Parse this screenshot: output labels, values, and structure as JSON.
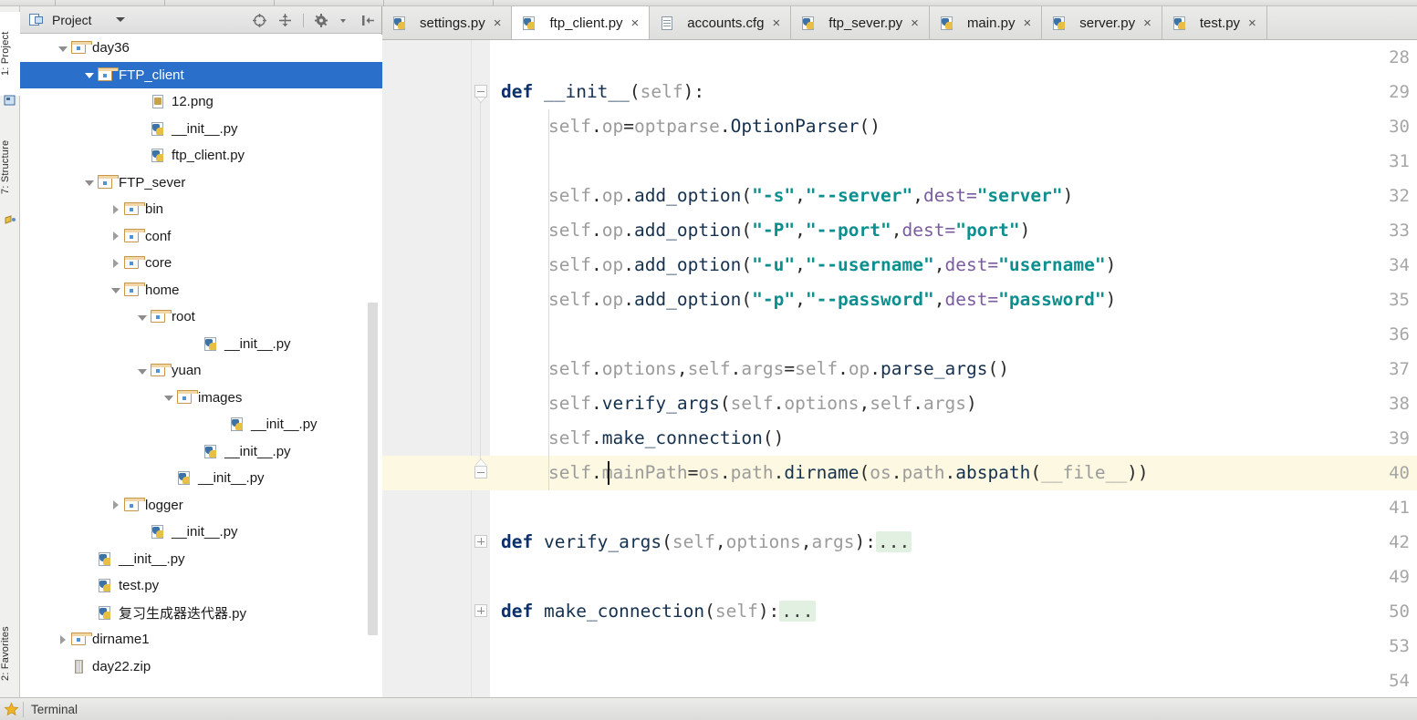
{
  "app": {
    "window_chrome": "pycharm-ide"
  },
  "rail": {
    "items": [
      {
        "label": "1: Project",
        "icon": "project-icon",
        "active": true
      },
      {
        "label": "7: Structure",
        "icon": "structure-icon",
        "active": false
      },
      {
        "label": "2: Favorites",
        "icon": "favorites-icon",
        "active": false
      }
    ]
  },
  "project_panel": {
    "title": "Project",
    "title_icon": "project-view-icon",
    "dropdown_icon": "chevron-down-icon",
    "tools": [
      {
        "name": "locate-target-icon",
        "label": "Select Opened File"
      },
      {
        "name": "collapse-all-icon",
        "label": "Collapse All"
      },
      {
        "name": "settings-gear-icon",
        "label": "Settings"
      },
      {
        "name": "hide-panel-icon",
        "label": "Hide"
      }
    ],
    "tree": [
      {
        "label": "day36",
        "indent": 1,
        "twisty": "down",
        "icon": "folder-icon",
        "selected": false
      },
      {
        "label": "FTP_client",
        "indent": 2,
        "twisty": "down",
        "icon": "folder-icon",
        "selected": true
      },
      {
        "label": "12.png",
        "indent": 4,
        "twisty": "none",
        "icon": "image-file-icon",
        "selected": false
      },
      {
        "label": "__init__.py",
        "indent": 4,
        "twisty": "none",
        "icon": "python-file-icon",
        "selected": false
      },
      {
        "label": "ftp_client.py",
        "indent": 4,
        "twisty": "none",
        "icon": "python-file-icon",
        "selected": false
      },
      {
        "label": "FTP_sever",
        "indent": 2,
        "twisty": "down",
        "icon": "folder-icon",
        "selected": false
      },
      {
        "label": "bin",
        "indent": 3,
        "twisty": "right",
        "icon": "folder-icon",
        "selected": false
      },
      {
        "label": "conf",
        "indent": 3,
        "twisty": "right",
        "icon": "folder-icon",
        "selected": false
      },
      {
        "label": "core",
        "indent": 3,
        "twisty": "right",
        "icon": "folder-icon",
        "selected": false
      },
      {
        "label": "home",
        "indent": 3,
        "twisty": "down",
        "icon": "folder-icon",
        "selected": false
      },
      {
        "label": "root",
        "indent": 4,
        "twisty": "down",
        "icon": "folder-icon",
        "selected": false
      },
      {
        "label": "__init__.py",
        "indent": 6,
        "twisty": "none",
        "icon": "python-file-icon",
        "selected": false
      },
      {
        "label": "yuan",
        "indent": 4,
        "twisty": "down",
        "icon": "folder-icon",
        "selected": false
      },
      {
        "label": "images",
        "indent": 5,
        "twisty": "down",
        "icon": "folder-icon",
        "selected": false
      },
      {
        "label": "__init__.py",
        "indent": 7,
        "twisty": "none",
        "icon": "python-file-icon",
        "selected": false
      },
      {
        "label": "__init__.py",
        "indent": 6,
        "twisty": "none",
        "icon": "python-file-icon",
        "selected": false
      },
      {
        "label": "__init__.py",
        "indent": 5,
        "twisty": "none",
        "icon": "python-file-icon",
        "selected": false
      },
      {
        "label": "logger",
        "indent": 3,
        "twisty": "right",
        "icon": "folder-icon",
        "selected": false
      },
      {
        "label": "__init__.py",
        "indent": 4,
        "twisty": "none",
        "icon": "python-file-icon",
        "selected": false
      },
      {
        "label": "__init__.py",
        "indent": 2,
        "twisty": "none",
        "icon": "python-file-icon",
        "selected": false
      },
      {
        "label": "test.py",
        "indent": 2,
        "twisty": "none",
        "icon": "python-file-icon",
        "selected": false
      },
      {
        "label": "复习生成器迭代器.py",
        "indent": 2,
        "twisty": "none",
        "icon": "python-file-icon",
        "selected": false
      },
      {
        "label": "dirname1",
        "indent": 1,
        "twisty": "right",
        "icon": "folder-icon",
        "selected": false
      },
      {
        "label": "day22.zip",
        "indent": 1,
        "twisty": "none",
        "icon": "zip-file-icon",
        "selected": false
      }
    ]
  },
  "editor": {
    "tabs": [
      {
        "label": "settings.py",
        "icon": "python-file-icon",
        "active": false,
        "close": "×"
      },
      {
        "label": "ftp_client.py",
        "icon": "python-file-icon",
        "active": true,
        "close": "×"
      },
      {
        "label": "accounts.cfg",
        "icon": "config-file-icon",
        "active": false,
        "close": "×"
      },
      {
        "label": "ftp_sever.py",
        "icon": "python-file-icon",
        "active": false,
        "close": "×"
      },
      {
        "label": "main.py",
        "icon": "python-file-icon",
        "active": false,
        "close": "×"
      },
      {
        "label": "server.py",
        "icon": "python-file-icon",
        "active": false,
        "close": "×"
      },
      {
        "label": "test.py",
        "icon": "python-file-icon",
        "active": false,
        "close": "×"
      }
    ],
    "current_line": 40,
    "lines": [
      {
        "num": "28",
        "fold": "none"
      },
      {
        "num": "29",
        "fold": "minus-start"
      },
      {
        "num": "30",
        "fold": "none"
      },
      {
        "num": "31",
        "fold": "none"
      },
      {
        "num": "32",
        "fold": "none"
      },
      {
        "num": "33",
        "fold": "none"
      },
      {
        "num": "34",
        "fold": "none"
      },
      {
        "num": "35",
        "fold": "none"
      },
      {
        "num": "36",
        "fold": "none"
      },
      {
        "num": "37",
        "fold": "none"
      },
      {
        "num": "38",
        "fold": "none"
      },
      {
        "num": "39",
        "fold": "none"
      },
      {
        "num": "40",
        "fold": "end"
      },
      {
        "num": "41",
        "fold": "none"
      },
      {
        "num": "42",
        "fold": "plus"
      },
      {
        "num": "49",
        "fold": "none"
      },
      {
        "num": "50",
        "fold": "plus"
      },
      {
        "num": "53",
        "fold": "none"
      },
      {
        "num": "54",
        "fold": "none"
      }
    ],
    "code": {
      "l29": "def __init__(self):",
      "l30": "self.op=optparse.OptionParser()",
      "l32_a": "self.op.add_option(",
      "l32_s1": "\"-s\"",
      "l32_s2": "\"--server\"",
      "l32_kw": "dest=",
      "l32_s3": "\"server\"",
      "l33_s1": "\"-P\"",
      "l33_s2": "\"--port\"",
      "l33_s3": "\"port\"",
      "l34_s1": "\"-u\"",
      "l34_s2": "\"--username\"",
      "l34_s3": "\"username\"",
      "l35_s1": "\"-p\"",
      "l35_s2": "\"--password\"",
      "l35_s3": "\"password\"",
      "l37": "self.options,self.args=self.op.parse_args()",
      "l38": "self.verify_args(self.options,self.args)",
      "l39": "self.make_connection()",
      "l40": "self.mainPath=os.path.dirname(os.path.abspath(__file__))",
      "l42_kw": "def",
      "l42_name": "verify_args",
      "l42_args": "(self,options,args):",
      "l42_dots": "...",
      "l50_kw": "def",
      "l50_name": "make_connection",
      "l50_args": "(self):",
      "l50_dots": "..."
    }
  },
  "bottom_bar": {
    "favorites_icon": "star-icon",
    "terminal_label": "Terminal"
  },
  "colors": {
    "selection_blue": "#2a6fc9",
    "string_teal": "#0b8f8f",
    "keyword_navy": "#0b2f6b",
    "current_line": "#fdf8e2",
    "fold_green": "#e2f0e2"
  }
}
